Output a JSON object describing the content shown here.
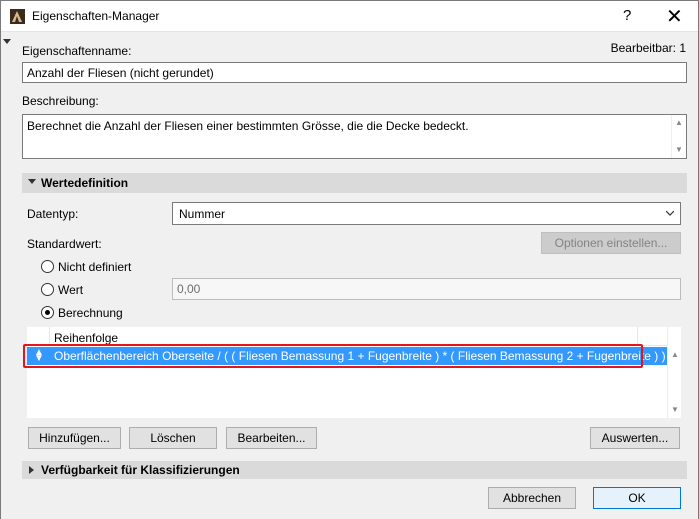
{
  "window": {
    "title": "Eigenschaften-Manager",
    "help": "?",
    "close": "✕"
  },
  "property": {
    "name_label": "Eigenschaftenname:",
    "editable_status": "Bearbeitbar: 1",
    "name_value": "Anzahl der Fliesen (nicht gerundet)",
    "description_label": "Beschreibung:",
    "description_value": "Berechnet die Anzahl der Fliesen einer bestimmten Grösse, die die Decke bedeckt."
  },
  "value_definition": {
    "section_title": "Wertedefinition",
    "datatype_label": "Datentyp:",
    "datatype_value": "Nummer",
    "default_label": "Standardwert:",
    "options_button": "Optionen einstellen...",
    "radio_undefined": "Nicht definiert",
    "radio_value": "Wert",
    "radio_calculation": "Berechnung",
    "value_field": "0,00",
    "selected_option": "Berechnung"
  },
  "list": {
    "column_header": "Reihenfolge",
    "rows": [
      {
        "sort_icon": "sort-updown-icon",
        "formula": "Oberflächenbereich Oberseite / ( ( Fliesen Bemassung 1 + Fugenbreite ) * ( Fliesen Bemassung 2 + Fugenbreite ) )",
        "selected": true
      }
    ]
  },
  "list_buttons": {
    "add": "Hinzufügen...",
    "delete": "Löschen",
    "edit": "Bearbeiten...",
    "evaluate": "Auswerten..."
  },
  "availability": {
    "section_title": "Verfügbarkeit für Klassifizierungen"
  },
  "footer": {
    "cancel": "Abbrechen",
    "ok": "OK"
  },
  "colors": {
    "selection": "#3399ff",
    "highlight_border": "#e8141b",
    "primary_button_border": "#0078d7"
  }
}
